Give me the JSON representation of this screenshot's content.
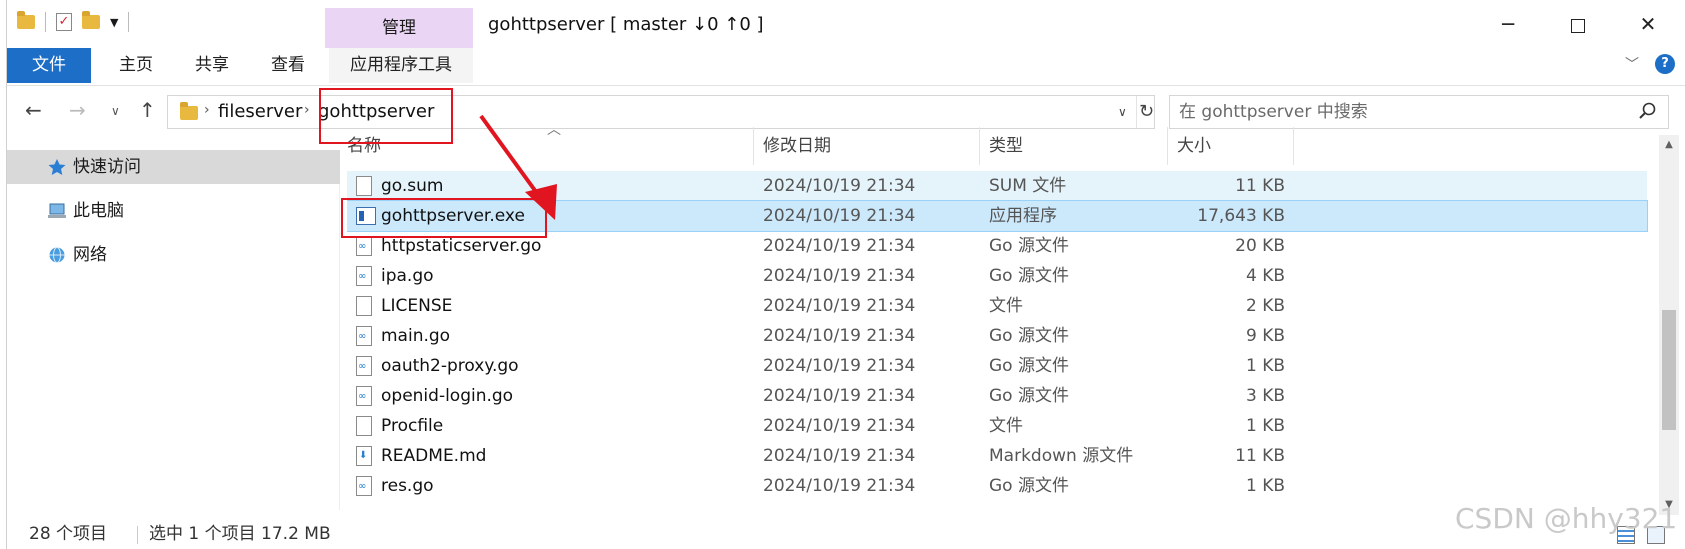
{
  "window": {
    "title": "gohttpserver [ master ↓0 ↑0 ]",
    "context_tab": "管理"
  },
  "ribbon": {
    "tabs": [
      "文件",
      "主页",
      "共享",
      "查看",
      "应用程序工具"
    ]
  },
  "address": {
    "crumbs": [
      "fileserver",
      "gohttpserver"
    ]
  },
  "search": {
    "placeholder": "在 gohttpserver 中搜索"
  },
  "sidebar": {
    "items": [
      {
        "label": "快速访问",
        "icon": "star-icon"
      },
      {
        "label": "此电脑",
        "icon": "computer-icon"
      },
      {
        "label": "网络",
        "icon": "network-icon"
      }
    ]
  },
  "columns": {
    "name": "名称",
    "date": "修改日期",
    "type": "类型",
    "size": "大小"
  },
  "files": [
    {
      "name": "go.sum",
      "date": "2024/10/19 21:34",
      "type": "SUM 文件",
      "size": "11 KB",
      "icon": "file-icon"
    },
    {
      "name": "gohttpserver.exe",
      "date": "2024/10/19 21:34",
      "type": "应用程序",
      "size": "17,643 KB",
      "icon": "exe-icon"
    },
    {
      "name": "httpstaticserver.go",
      "date": "2024/10/19 21:34",
      "type": "Go 源文件",
      "size": "20 KB",
      "icon": "go-file-icon"
    },
    {
      "name": "ipa.go",
      "date": "2024/10/19 21:34",
      "type": "Go 源文件",
      "size": "4 KB",
      "icon": "go-file-icon"
    },
    {
      "name": "LICENSE",
      "date": "2024/10/19 21:34",
      "type": "文件",
      "size": "2 KB",
      "icon": "file-icon"
    },
    {
      "name": "main.go",
      "date": "2024/10/19 21:34",
      "type": "Go 源文件",
      "size": "9 KB",
      "icon": "go-file-icon"
    },
    {
      "name": "oauth2-proxy.go",
      "date": "2024/10/19 21:34",
      "type": "Go 源文件",
      "size": "1 KB",
      "icon": "go-file-icon"
    },
    {
      "name": "openid-login.go",
      "date": "2024/10/19 21:34",
      "type": "Go 源文件",
      "size": "3 KB",
      "icon": "go-file-icon"
    },
    {
      "name": "Procfile",
      "date": "2024/10/19 21:34",
      "type": "文件",
      "size": "1 KB",
      "icon": "file-icon"
    },
    {
      "name": "README.md",
      "date": "2024/10/19 21:34",
      "type": "Markdown 源文件",
      "size": "11 KB",
      "icon": "markdown-file-icon"
    },
    {
      "name": "res.go",
      "date": "2024/10/19 21:34",
      "type": "Go 源文件",
      "size": "1 KB",
      "icon": "go-file-icon"
    }
  ],
  "selected_file": "gohttpserver.exe",
  "status": {
    "count": "28 个项目",
    "selection": "选中 1 个项目  17.2 MB"
  },
  "watermark": "CSDN @hhy321",
  "colors": {
    "accent": "#1d6ec7",
    "context_tab": "#ead5f5",
    "selection": "#cce8fb",
    "annotation": "#e0151f"
  }
}
